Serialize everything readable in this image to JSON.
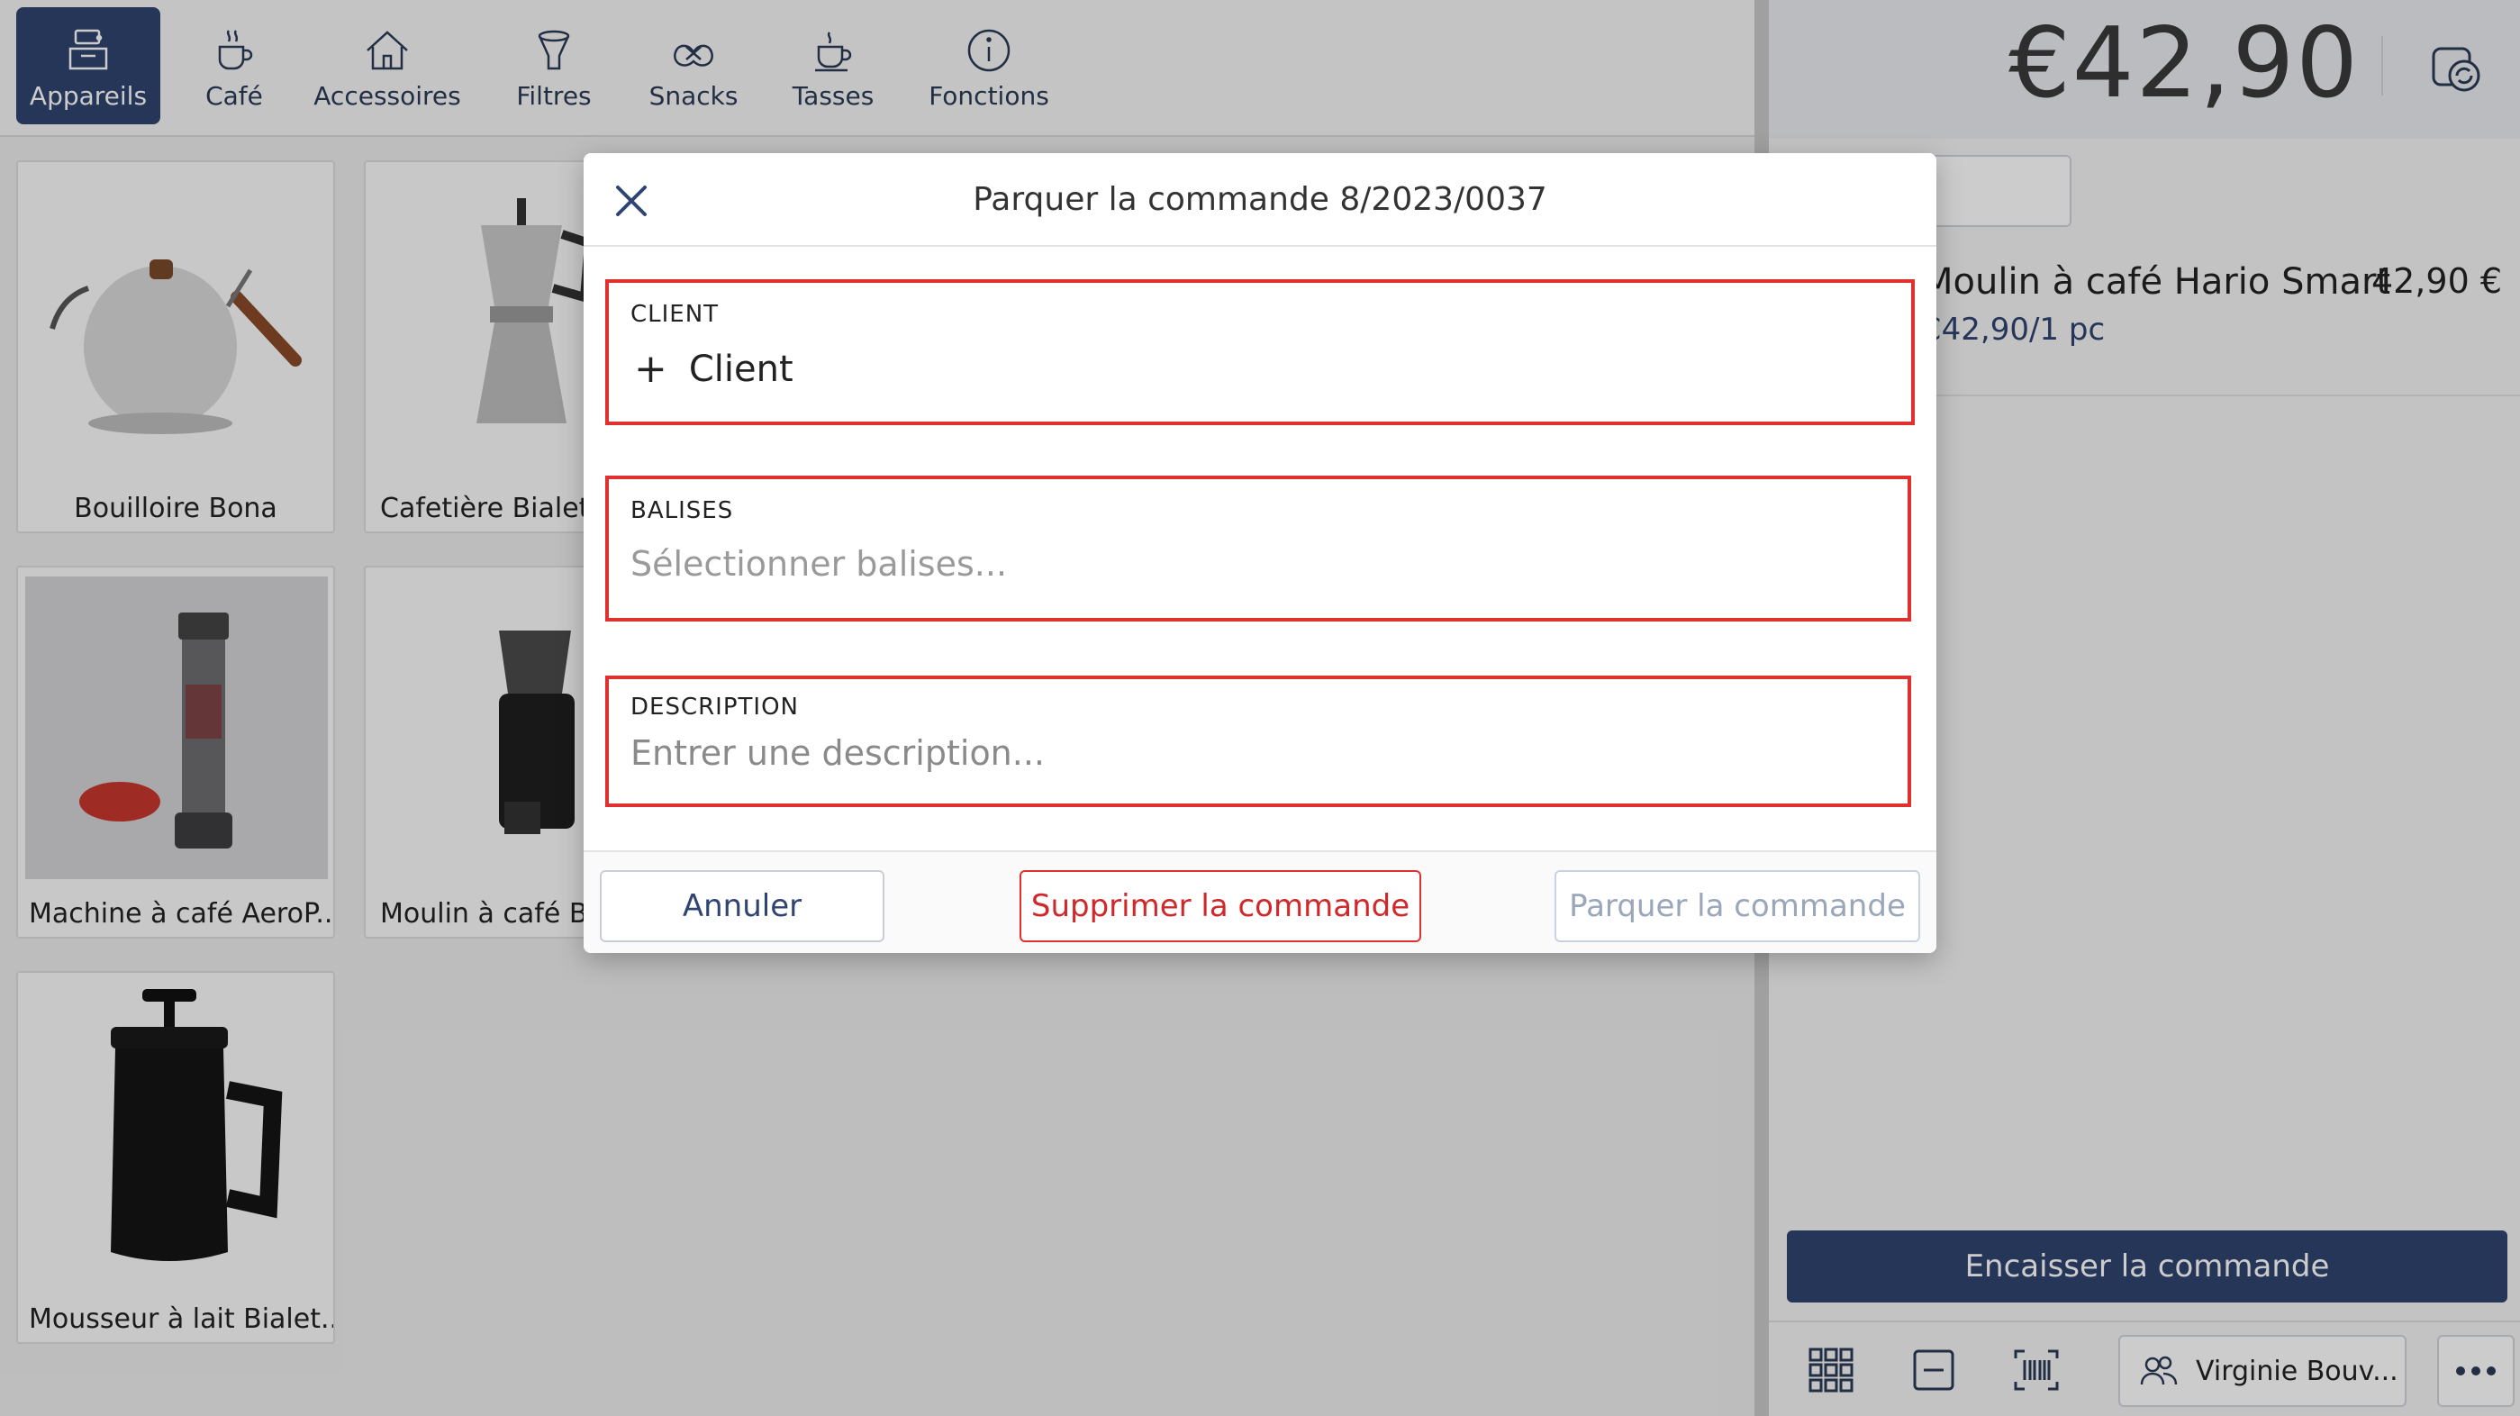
{
  "categories": [
    {
      "label": "Appareils",
      "icon": "appliances-icon",
      "active": true
    },
    {
      "label": "Café",
      "icon": "coffee-cup-icon",
      "active": false
    },
    {
      "label": "Accessoires",
      "icon": "house-icon",
      "active": false
    },
    {
      "label": "Filtres",
      "icon": "filter-icon",
      "active": false
    },
    {
      "label": "Snacks",
      "icon": "pretzel-icon",
      "active": false
    },
    {
      "label": "Tasses",
      "icon": "cup-icon",
      "active": false
    },
    {
      "label": "Fonctions",
      "icon": "info-icon",
      "active": false
    }
  ],
  "products": [
    {
      "name": "Bouilloire Bona"
    },
    {
      "name": "Cafetière Bialetti"
    },
    {
      "name": "Machine à café AeroP..."
    },
    {
      "name": "Moulin à café Bar"
    },
    {
      "name": "Mousseur à lait Bialet..."
    }
  ],
  "order": {
    "total": "€42,90",
    "items": [
      {
        "name": "Moulin à café Hario Smart",
        "price": "42,90 €",
        "unit": "€42,90/1 pc"
      }
    ],
    "checkout_label": "Encaisser la commande",
    "user_label": "Virginie Bouv..."
  },
  "modal": {
    "title": "Parquer la commande 8/2023/0037",
    "client_label": "CLIENT",
    "client_add": "Client",
    "tags_label": "BALISES",
    "tags_placeholder": "Sélectionner balises...",
    "description_label": "DESCRIPTION",
    "description_placeholder": "Entrer une description...",
    "cancel_label": "Annuler",
    "delete_label": "Supprimer la commande",
    "park_label": "Parquer la commande"
  },
  "colors": {
    "accent": "#2f4470",
    "highlight": "#e0312e",
    "danger_text": "#d0282a"
  }
}
